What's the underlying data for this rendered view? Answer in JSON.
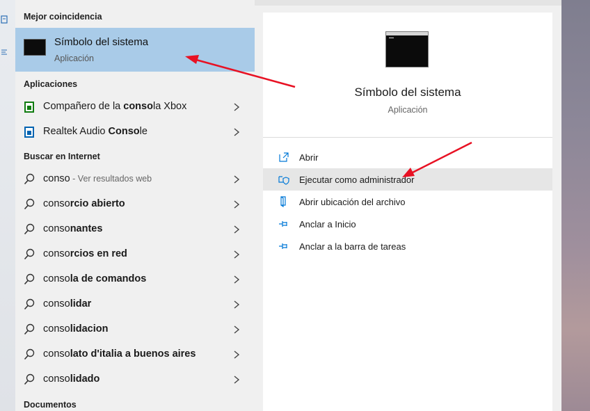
{
  "sections": {
    "best_match": "Mejor coincidencia",
    "apps": "Aplicaciones",
    "web": "Buscar en Internet",
    "docs": "Documentos"
  },
  "best_match": {
    "title": "Símbolo del sistema",
    "subtitle": "Aplicación"
  },
  "apps": [
    {
      "pre": "Compañero de la ",
      "bold": "conso",
      "post": "la Xbox"
    },
    {
      "pre": "Realtek Audio ",
      "bold": "Conso",
      "post": "le"
    }
  ],
  "web": [
    {
      "plain": "conso",
      "bold": "",
      "hint": " - Ver resultados web"
    },
    {
      "plain": "conso",
      "bold": "rcio abierto",
      "hint": ""
    },
    {
      "plain": "conso",
      "bold": "nantes",
      "hint": ""
    },
    {
      "plain": "conso",
      "bold": "rcios en red",
      "hint": ""
    },
    {
      "plain": "conso",
      "bold": "la de comandos",
      "hint": ""
    },
    {
      "plain": "conso",
      "bold": "lidar",
      "hint": ""
    },
    {
      "plain": "conso",
      "bold": "lidacion",
      "hint": ""
    },
    {
      "plain": "conso",
      "bold": "lato d'italia a buenos aires",
      "hint": ""
    },
    {
      "plain": "conso",
      "bold": "lidado",
      "hint": ""
    }
  ],
  "detail": {
    "title": "Símbolo del sistema",
    "subtitle": "Aplicación",
    "actions": [
      {
        "label": "Abrir",
        "icon": "open-icon"
      },
      {
        "label": "Ejecutar como administrador",
        "icon": "shield-icon"
      },
      {
        "label": "Abrir ubicación del archivo",
        "icon": "file-location-icon"
      },
      {
        "label": "Anclar a Inicio",
        "icon": "pin-icon"
      },
      {
        "label": "Anclar a la barra de tareas",
        "icon": "pin-icon"
      }
    ]
  },
  "colors": {
    "selected": "#a9cbe8",
    "accent": "#0078d7",
    "annotation_arrow": "#e81123"
  }
}
